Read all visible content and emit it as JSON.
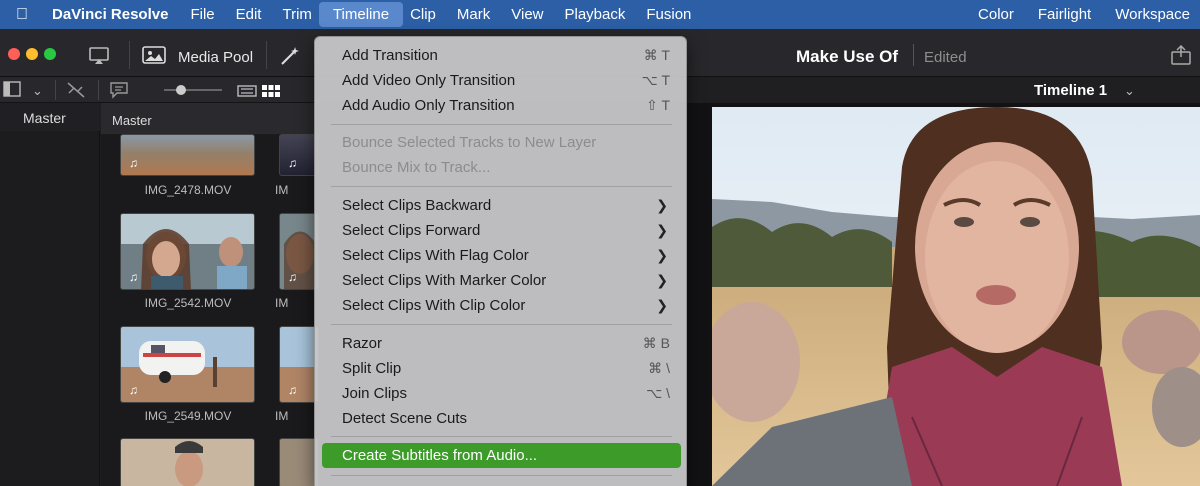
{
  "menubar": {
    "app_name": "DaVinci Resolve",
    "items": [
      "File",
      "Edit",
      "Trim",
      "Timeline",
      "Clip",
      "Mark",
      "View",
      "Playback",
      "Fusion"
    ],
    "active_item": "Timeline",
    "right_items": [
      "Color",
      "Fairlight",
      "Workspace"
    ]
  },
  "toolbar": {
    "media_pool_label": "Media Pool",
    "project_title": "Make Use Of",
    "project_status": "Edited",
    "timeline_name": "Timeline 1"
  },
  "bins": {
    "master_label": "Master",
    "pool_label": "Master"
  },
  "clips": [
    {
      "name": "IMG_2478.MOV"
    },
    {
      "name": "IMG_2542.MOV"
    },
    {
      "name": "IMG_2549.MOV"
    }
  ],
  "timeline_menu": {
    "group1": [
      {
        "label": "Add Transition",
        "shortcut": "⌘ T"
      },
      {
        "label": "Add Video Only Transition",
        "shortcut": "⌥ T"
      },
      {
        "label": "Add Audio Only Transition",
        "shortcut": "⇧ T"
      }
    ],
    "group2": [
      {
        "label": "Bounce Selected Tracks to New Layer"
      },
      {
        "label": "Bounce Mix to Track..."
      }
    ],
    "group3": [
      {
        "label": "Select Clips Backward"
      },
      {
        "label": "Select Clips Forward"
      },
      {
        "label": "Select Clips With Flag Color"
      },
      {
        "label": "Select Clips With Marker Color"
      },
      {
        "label": "Select Clips With Clip Color"
      }
    ],
    "group4": [
      {
        "label": "Razor",
        "shortcut": "⌘ B"
      },
      {
        "label": "Split Clip",
        "shortcut": "⌘ \\"
      },
      {
        "label": "Join Clips",
        "shortcut": "⌥ \\"
      },
      {
        "label": "Detect Scene Cuts"
      }
    ],
    "highlighted": {
      "label": "Create Subtitles from Audio..."
    }
  },
  "colors": {
    "menubar_bg": "#2c5fa6",
    "highlight_green": "#3d9b2a",
    "traffic_red": "#fe5f57",
    "traffic_yellow": "#febc2e",
    "traffic_green": "#28c840"
  }
}
